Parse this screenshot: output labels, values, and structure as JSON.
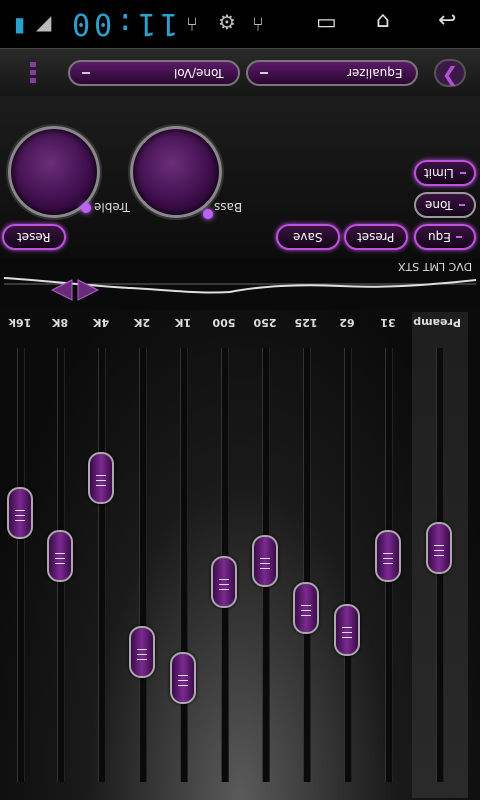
{
  "status": {
    "clock": "11:00"
  },
  "toolbar": {
    "tab_tone_vol": "Tone/Vol",
    "tab_equalizer": "Equalizer"
  },
  "controls": {
    "treble_label": "Treble",
    "bass_label": "Bass",
    "buttons": {
      "reset": "Reset",
      "save": "Save",
      "preset": "Preset",
      "equ": "Equ",
      "tone": "Tone",
      "limit": "Limit"
    }
  },
  "strip": {
    "label": "DVC LMT STX"
  },
  "eq": {
    "bands": [
      {
        "label": "16k",
        "level": 0.62
      },
      {
        "label": "8K",
        "level": 0.52
      },
      {
        "label": "4K",
        "level": 0.7
      },
      {
        "label": "2K",
        "level": 0.3
      },
      {
        "label": "1K",
        "level": 0.24
      },
      {
        "label": "500",
        "level": 0.46
      },
      {
        "label": "250",
        "level": 0.51
      },
      {
        "label": "125",
        "level": 0.4
      },
      {
        "label": "62",
        "level": 0.35
      },
      {
        "label": "31",
        "level": 0.52
      },
      {
        "label": "Preamp",
        "level": 0.54
      }
    ]
  },
  "colors": {
    "accent": "#c050e0",
    "knob": "#4a1458",
    "clock": "#2aa0cc"
  }
}
